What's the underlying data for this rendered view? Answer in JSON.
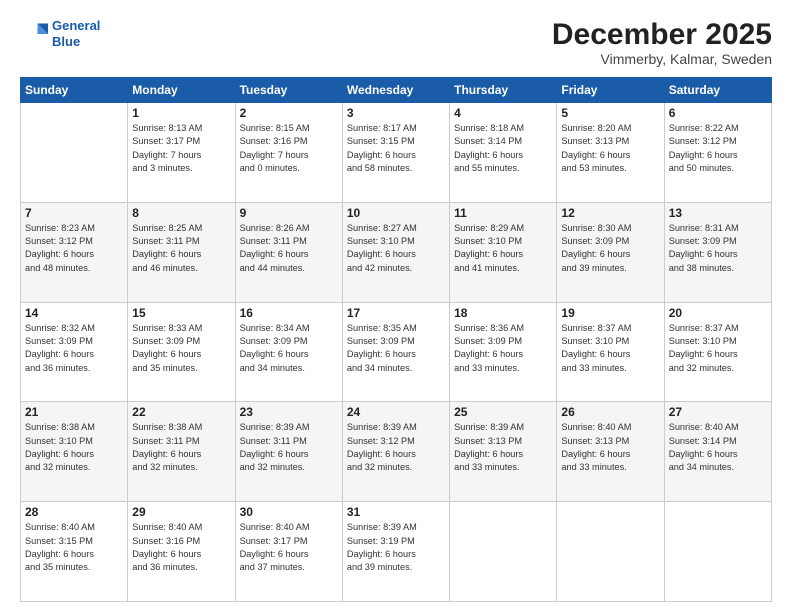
{
  "header": {
    "logo_line1": "General",
    "logo_line2": "Blue",
    "title": "December 2025",
    "subtitle": "Vimmerby, Kalmar, Sweden"
  },
  "days_of_week": [
    "Sunday",
    "Monday",
    "Tuesday",
    "Wednesday",
    "Thursday",
    "Friday",
    "Saturday"
  ],
  "weeks": [
    [
      {
        "day": "",
        "info": ""
      },
      {
        "day": "1",
        "info": "Sunrise: 8:13 AM\nSunset: 3:17 PM\nDaylight: 7 hours\nand 3 minutes."
      },
      {
        "day": "2",
        "info": "Sunrise: 8:15 AM\nSunset: 3:16 PM\nDaylight: 7 hours\nand 0 minutes."
      },
      {
        "day": "3",
        "info": "Sunrise: 8:17 AM\nSunset: 3:15 PM\nDaylight: 6 hours\nand 58 minutes."
      },
      {
        "day": "4",
        "info": "Sunrise: 8:18 AM\nSunset: 3:14 PM\nDaylight: 6 hours\nand 55 minutes."
      },
      {
        "day": "5",
        "info": "Sunrise: 8:20 AM\nSunset: 3:13 PM\nDaylight: 6 hours\nand 53 minutes."
      },
      {
        "day": "6",
        "info": "Sunrise: 8:22 AM\nSunset: 3:12 PM\nDaylight: 6 hours\nand 50 minutes."
      }
    ],
    [
      {
        "day": "7",
        "info": "Sunrise: 8:23 AM\nSunset: 3:12 PM\nDaylight: 6 hours\nand 48 minutes."
      },
      {
        "day": "8",
        "info": "Sunrise: 8:25 AM\nSunset: 3:11 PM\nDaylight: 6 hours\nand 46 minutes."
      },
      {
        "day": "9",
        "info": "Sunrise: 8:26 AM\nSunset: 3:11 PM\nDaylight: 6 hours\nand 44 minutes."
      },
      {
        "day": "10",
        "info": "Sunrise: 8:27 AM\nSunset: 3:10 PM\nDaylight: 6 hours\nand 42 minutes."
      },
      {
        "day": "11",
        "info": "Sunrise: 8:29 AM\nSunset: 3:10 PM\nDaylight: 6 hours\nand 41 minutes."
      },
      {
        "day": "12",
        "info": "Sunrise: 8:30 AM\nSunset: 3:09 PM\nDaylight: 6 hours\nand 39 minutes."
      },
      {
        "day": "13",
        "info": "Sunrise: 8:31 AM\nSunset: 3:09 PM\nDaylight: 6 hours\nand 38 minutes."
      }
    ],
    [
      {
        "day": "14",
        "info": "Sunrise: 8:32 AM\nSunset: 3:09 PM\nDaylight: 6 hours\nand 36 minutes."
      },
      {
        "day": "15",
        "info": "Sunrise: 8:33 AM\nSunset: 3:09 PM\nDaylight: 6 hours\nand 35 minutes."
      },
      {
        "day": "16",
        "info": "Sunrise: 8:34 AM\nSunset: 3:09 PM\nDaylight: 6 hours\nand 34 minutes."
      },
      {
        "day": "17",
        "info": "Sunrise: 8:35 AM\nSunset: 3:09 PM\nDaylight: 6 hours\nand 34 minutes."
      },
      {
        "day": "18",
        "info": "Sunrise: 8:36 AM\nSunset: 3:09 PM\nDaylight: 6 hours\nand 33 minutes."
      },
      {
        "day": "19",
        "info": "Sunrise: 8:37 AM\nSunset: 3:10 PM\nDaylight: 6 hours\nand 33 minutes."
      },
      {
        "day": "20",
        "info": "Sunrise: 8:37 AM\nSunset: 3:10 PM\nDaylight: 6 hours\nand 32 minutes."
      }
    ],
    [
      {
        "day": "21",
        "info": "Sunrise: 8:38 AM\nSunset: 3:10 PM\nDaylight: 6 hours\nand 32 minutes."
      },
      {
        "day": "22",
        "info": "Sunrise: 8:38 AM\nSunset: 3:11 PM\nDaylight: 6 hours\nand 32 minutes."
      },
      {
        "day": "23",
        "info": "Sunrise: 8:39 AM\nSunset: 3:11 PM\nDaylight: 6 hours\nand 32 minutes."
      },
      {
        "day": "24",
        "info": "Sunrise: 8:39 AM\nSunset: 3:12 PM\nDaylight: 6 hours\nand 32 minutes."
      },
      {
        "day": "25",
        "info": "Sunrise: 8:39 AM\nSunset: 3:13 PM\nDaylight: 6 hours\nand 33 minutes."
      },
      {
        "day": "26",
        "info": "Sunrise: 8:40 AM\nSunset: 3:13 PM\nDaylight: 6 hours\nand 33 minutes."
      },
      {
        "day": "27",
        "info": "Sunrise: 8:40 AM\nSunset: 3:14 PM\nDaylight: 6 hours\nand 34 minutes."
      }
    ],
    [
      {
        "day": "28",
        "info": "Sunrise: 8:40 AM\nSunset: 3:15 PM\nDaylight: 6 hours\nand 35 minutes."
      },
      {
        "day": "29",
        "info": "Sunrise: 8:40 AM\nSunset: 3:16 PM\nDaylight: 6 hours\nand 36 minutes."
      },
      {
        "day": "30",
        "info": "Sunrise: 8:40 AM\nSunset: 3:17 PM\nDaylight: 6 hours\nand 37 minutes."
      },
      {
        "day": "31",
        "info": "Sunrise: 8:39 AM\nSunset: 3:19 PM\nDaylight: 6 hours\nand 39 minutes."
      },
      {
        "day": "",
        "info": ""
      },
      {
        "day": "",
        "info": ""
      },
      {
        "day": "",
        "info": ""
      }
    ]
  ]
}
